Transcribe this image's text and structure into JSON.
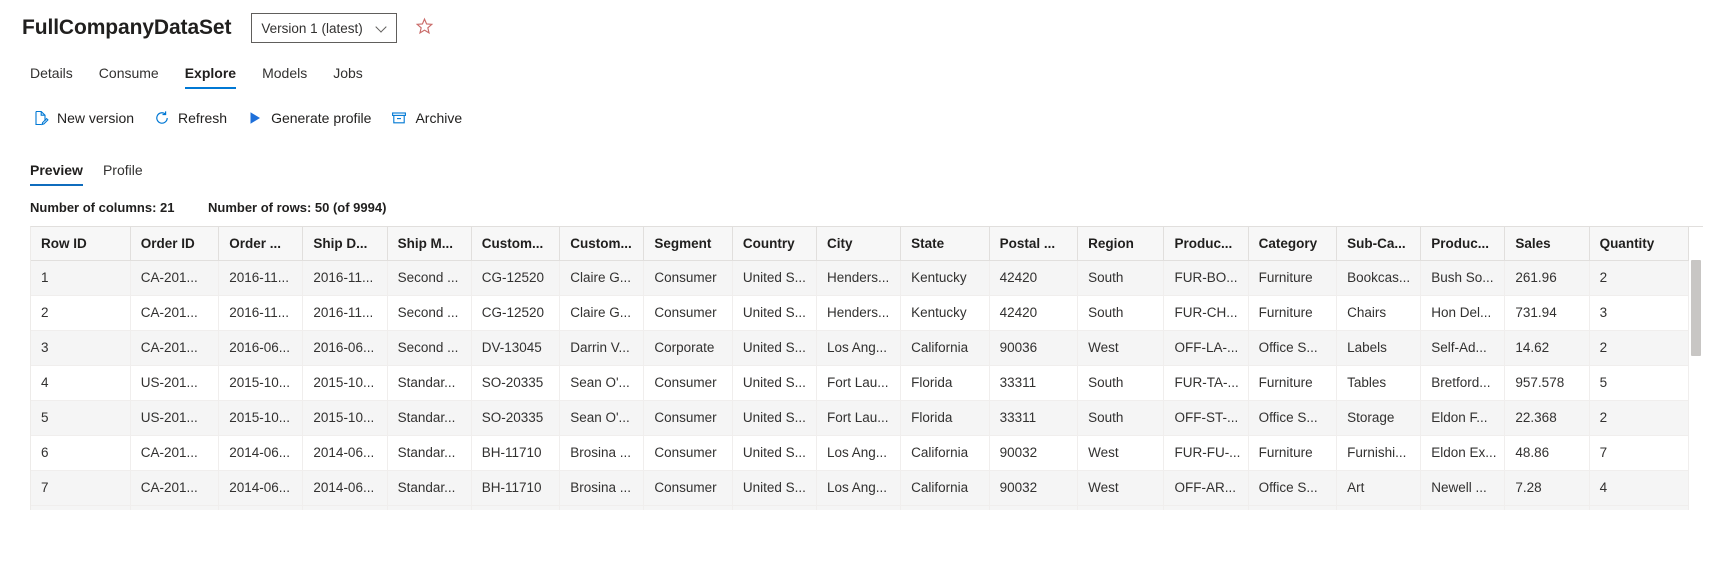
{
  "header": {
    "title": "FullCompanyDataSet",
    "version_label": "Version 1 (latest)",
    "favorite_icon": "★"
  },
  "main_tabs": [
    {
      "label": "Details",
      "active": false
    },
    {
      "label": "Consume",
      "active": false
    },
    {
      "label": "Explore",
      "active": true
    },
    {
      "label": "Models",
      "active": false
    },
    {
      "label": "Jobs",
      "active": false
    }
  ],
  "commands": [
    {
      "label": "New version",
      "icon": "new-version-icon"
    },
    {
      "label": "Refresh",
      "icon": "refresh-icon"
    },
    {
      "label": "Generate profile",
      "icon": "play-icon"
    },
    {
      "label": "Archive",
      "icon": "archive-icon"
    }
  ],
  "sub_tabs": [
    {
      "label": "Preview",
      "active": true
    },
    {
      "label": "Profile",
      "active": false
    }
  ],
  "counts": {
    "columns": "Number of columns: 21",
    "rows": "Number of rows: 50 (of 9994)"
  },
  "colors": {
    "accent": "#0078d4",
    "tab_underline": "#0f6cbd",
    "star": "#c96a68",
    "header_bg": "#f7f7f7",
    "row_alt_bg": "#f5f5f5"
  },
  "table": {
    "columns": [
      "Row ID",
      "Order ID",
      "Order ...",
      "Ship D...",
      "Ship M...",
      "Custom...",
      "Custom...",
      "Segment",
      "Country",
      "City",
      "State",
      "Postal ...",
      "Region",
      "Produc...",
      "Category",
      "Sub-Ca...",
      "Produc...",
      "Sales",
      "Quantity"
    ],
    "rows": [
      [
        "1",
        "CA-201...",
        "2016-11...",
        "2016-11...",
        "Second ...",
        "CG-12520",
        "Claire G...",
        "Consumer",
        "United S...",
        "Henders...",
        "Kentucky",
        "42420",
        "South",
        "FUR-BO...",
        "Furniture",
        "Bookcas...",
        "Bush So...",
        "261.96",
        "2"
      ],
      [
        "2",
        "CA-201...",
        "2016-11...",
        "2016-11...",
        "Second ...",
        "CG-12520",
        "Claire G...",
        "Consumer",
        "United S...",
        "Henders...",
        "Kentucky",
        "42420",
        "South",
        "FUR-CH...",
        "Furniture",
        "Chairs",
        "Hon Del...",
        "731.94",
        "3"
      ],
      [
        "3",
        "CA-201...",
        "2016-06...",
        "2016-06...",
        "Second ...",
        "DV-13045",
        "Darrin V...",
        "Corporate",
        "United S...",
        "Los Ang...",
        "California",
        "90036",
        "West",
        "OFF-LA-...",
        "Office S...",
        "Labels",
        "Self-Ad...",
        "14.62",
        "2"
      ],
      [
        "4",
        "US-201...",
        "2015-10...",
        "2015-10...",
        "Standar...",
        "SO-20335",
        "Sean O'...",
        "Consumer",
        "United S...",
        "Fort Lau...",
        "Florida",
        "33311",
        "South",
        "FUR-TA-...",
        "Furniture",
        "Tables",
        "Bretford...",
        "957.578",
        "5"
      ],
      [
        "5",
        "US-201...",
        "2015-10...",
        "2015-10...",
        "Standar...",
        "SO-20335",
        "Sean O'...",
        "Consumer",
        "United S...",
        "Fort Lau...",
        "Florida",
        "33311",
        "South",
        "OFF-ST-...",
        "Office S...",
        "Storage",
        "Eldon F...",
        "22.368",
        "2"
      ],
      [
        "6",
        "CA-201...",
        "2014-06...",
        "2014-06...",
        "Standar...",
        "BH-11710",
        "Brosina ...",
        "Consumer",
        "United S...",
        "Los Ang...",
        "California",
        "90032",
        "West",
        "FUR-FU-...",
        "Furniture",
        "Furnishi...",
        "Eldon Ex...",
        "48.86",
        "7"
      ],
      [
        "7",
        "CA-201...",
        "2014-06...",
        "2014-06...",
        "Standar...",
        "BH-11710",
        "Brosina ...",
        "Consumer",
        "United S...",
        "Los Ang...",
        "California",
        "90032",
        "West",
        "OFF-AR...",
        "Office S...",
        "Art",
        "Newell ...",
        "7.28",
        "4"
      ]
    ]
  }
}
